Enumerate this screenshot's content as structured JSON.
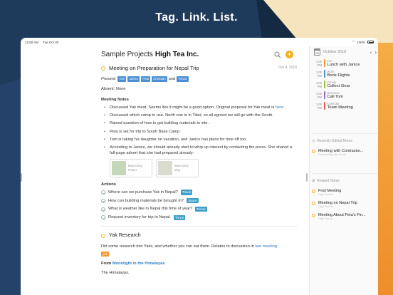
{
  "headline": "Tag. Link. List.",
  "status_bar": {
    "time": "12:50 AM",
    "date": "Tue Oct 30",
    "battery": "100%"
  },
  "header": {
    "project_light": "Sample Projects",
    "project_bold": "High Tea Inc."
  },
  "icons": {
    "search": "search-icon",
    "add": "plus-icon"
  },
  "note": {
    "title": "Meeting on Preparation for Nepal Trip",
    "date": "Oct 4, 2018",
    "present_label": "Present:",
    "present_tags": [
      "Tom",
      "Janice",
      "Peta",
      "Christian"
    ],
    "and": "and",
    "present_last": "Trevor",
    "absent": "Absent: None",
    "meeting_notes_heading": "Meeting Notes",
    "bullets": [
      {
        "text": "Discussed Yak meat. Seems like it might be a good option. Original proposal for Yak meat is ",
        "link": "here",
        "after": "."
      },
      {
        "text": "Discussed which camp to use. North one is in Tibet, so all agreed we will go with the South."
      },
      {
        "text": "Raised question of how to get building materials to site."
      },
      {
        "text": "Peta is set for trip to South Base Camp."
      },
      {
        "text": "Tom is taking his daughter on vacation, and Janice has plans for time off too."
      },
      {
        "text": "According to Janice, we should already start to whip up interest by contacting the press. She shared a full-page advert that she had prepared already:"
      }
    ],
    "attachments": [
      {
        "title": "Basecamp",
        "subtitle": "Poster"
      },
      {
        "title": "Basecamp",
        "subtitle": "Map"
      }
    ],
    "actions_heading": "Actions",
    "actions": [
      {
        "text": "Where can we purchase Yak in Nepal?",
        "tag": "Trevor"
      },
      {
        "text": "How can building materials be brought in?",
        "tag": "Janice"
      },
      {
        "text": "What is weather like in Nepal this time of year?",
        "tag": "Trevor"
      },
      {
        "text": "Request inventory for trip to Nepal.",
        "tag": "Trevor"
      }
    ]
  },
  "note2": {
    "title": "Yak Research",
    "body_prefix": "Did some research into Yaks, and whether you can eat them. Relates to discussion in ",
    "body_link": "last meeting",
    "body_suffix": ".",
    "tag": "yak",
    "from_label": "From",
    "from_link": "Moonlight in the Himalayas",
    "body2": "The Himalayas."
  },
  "sidebar": {
    "month": "October 2018",
    "day_num": "29",
    "events": [
      {
        "time": "1:00 PM",
        "category": "Fun",
        "title": "Lunch with Janice",
        "color": "#f0962e"
      },
      {
        "time": "1:00 PM",
        "category": "Work",
        "title": "Book Flights",
        "color": "#4c8fd4"
      },
      {
        "time": "1:00 PM",
        "category": "Family",
        "title": "Collect Gear",
        "color": "#9bbf3a"
      },
      {
        "time": "1:00 PM",
        "category": "Business",
        "title": "Call Tom",
        "color": "#8e6bbf"
      },
      {
        "time": "1:00 PM",
        "category": "Calendar",
        "title": "Team Meeting",
        "color": "#e05a5a"
      }
    ],
    "recently_edited_label": "Recently Edited Notes",
    "recent_note": {
      "title": "Meeting with Contractor...",
      "sub": "Remodeling Yak Fence"
    },
    "related_label": "Related Notes",
    "related": [
      {
        "title": "First Meeting",
        "sub": "High Tea Inc."
      },
      {
        "title": "Meeting on Nepal Trip",
        "sub": "High Tea Inc."
      },
      {
        "title": "Meeting About Peta's Fin...",
        "sub": "High Tea Inc."
      }
    ]
  },
  "colors": {
    "accent": "#f5b020",
    "link": "#2f7fc9",
    "tag": "#4c8fd4"
  }
}
